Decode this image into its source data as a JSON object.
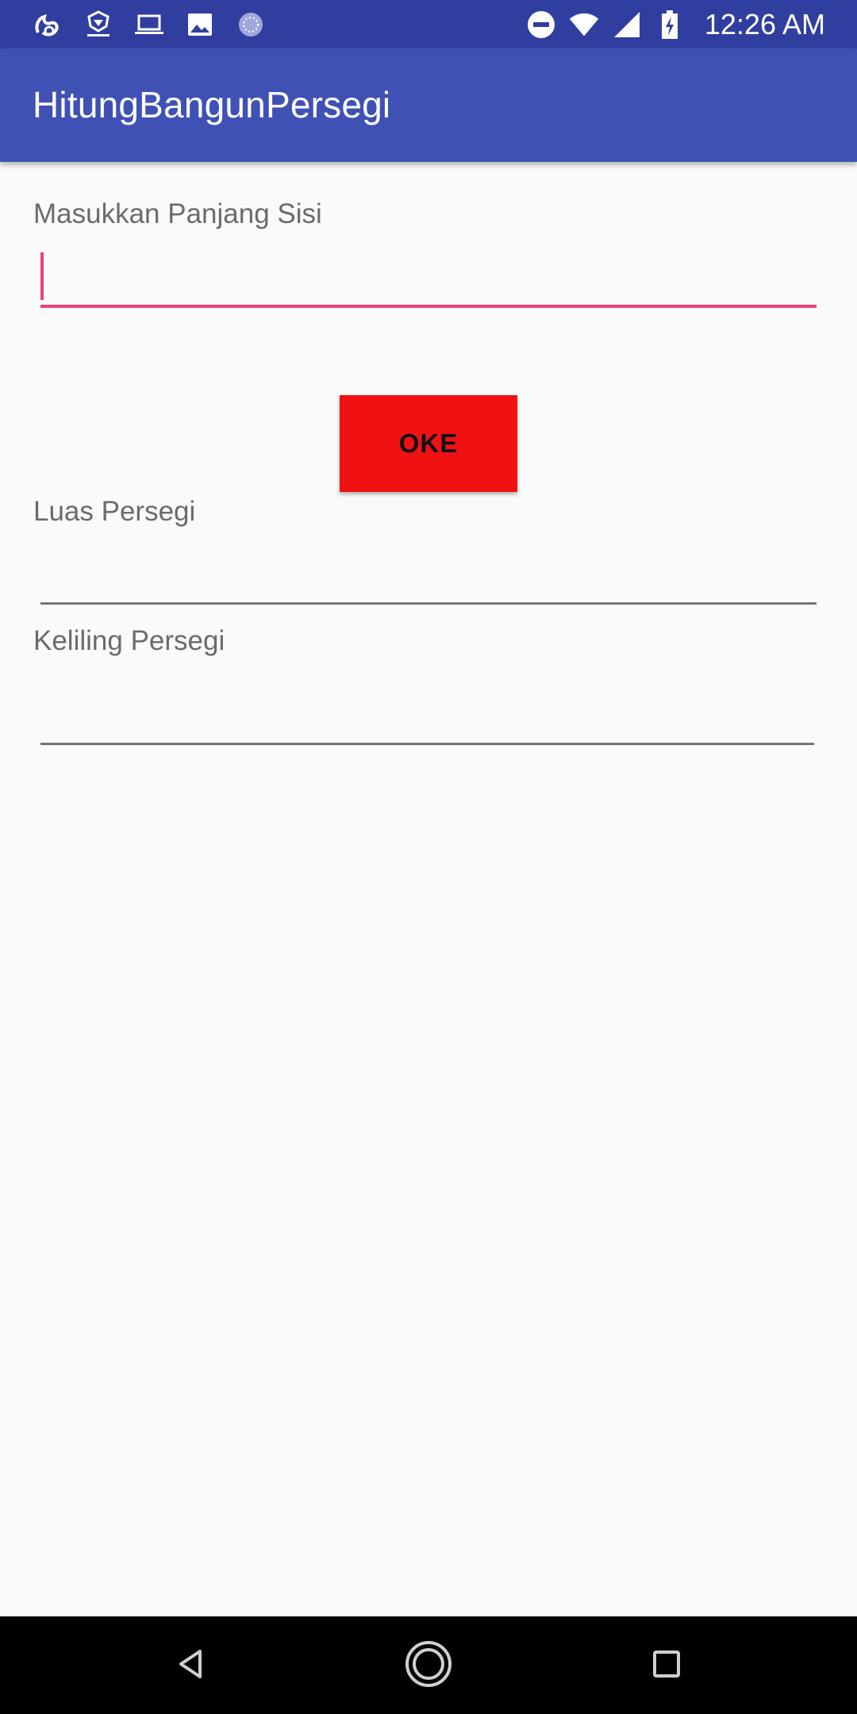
{
  "status_bar": {
    "time": "12:26 AM",
    "left_icons": [
      "uc-browser-icon",
      "garuda-logo-icon",
      "laptop-icon",
      "image-icon",
      "sync-dots-icon"
    ],
    "right_icons": [
      "do-not-disturb-icon",
      "wifi-icon",
      "signal-icon",
      "battery-charging-icon"
    ],
    "background": "#303f9f"
  },
  "app_bar": {
    "title": "HitungBangunPersegi",
    "background": "#3f51b5"
  },
  "form": {
    "side_label": "Masukkan Panjang Sisi",
    "side_value": "",
    "button_label": "OKE",
    "area_label": "Luas Persegi",
    "area_value": "",
    "perimeter_label": "Keliling Persegi",
    "perimeter_value": "",
    "accent_color": "#ec407a",
    "button_color": "#f01212"
  },
  "nav_bar": {
    "buttons": [
      "back-icon",
      "home-icon",
      "recents-icon"
    ]
  }
}
